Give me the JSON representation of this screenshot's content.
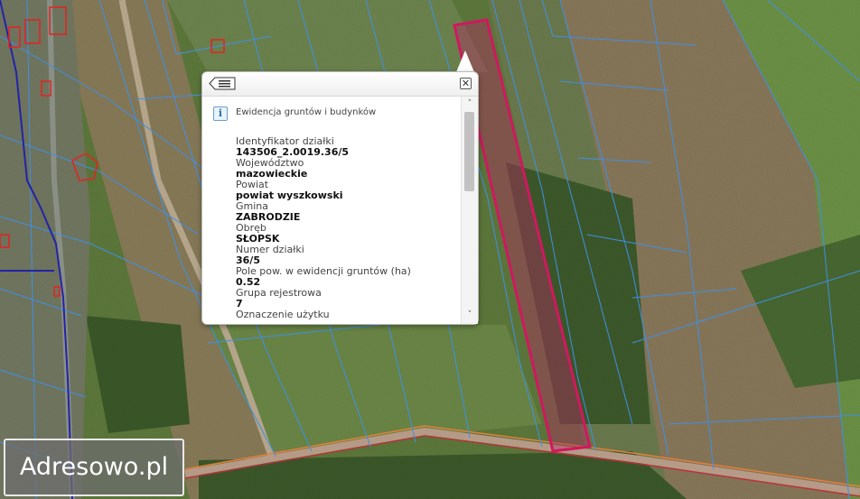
{
  "map": {
    "colors": {
      "field": "#5d7a3c",
      "parcel_line": "#3f8fe8",
      "highlight": "#d0185f",
      "building": "#e52222",
      "road": "#b59b87"
    }
  },
  "popup": {
    "list_icon": "list-back-icon",
    "close_icon": "close-icon",
    "layer_icon": "info-icon",
    "layer_icon_glyph": "i",
    "layer_title": "Ewidencja gruntów i budynków",
    "fields": [
      {
        "label": "Identyfikator działki",
        "value": "143506_2.0019.36/5"
      },
      {
        "label": "Województwo",
        "value": "mazowieckie"
      },
      {
        "label": "Powiat",
        "value": "powiat wyszkowski"
      },
      {
        "label": "Gmina",
        "value": "ZABRODZIE"
      },
      {
        "label": "Obręb",
        "value": "SŁOPSK"
      },
      {
        "label": "Numer działki",
        "value": "36/5"
      },
      {
        "label": "Pole pow. w ewidencji gruntów (ha)",
        "value": "0.52"
      },
      {
        "label": "Grupa rejestrowa",
        "value": "7"
      },
      {
        "label": "Oznaczenie użytku",
        "value": ""
      }
    ],
    "scrollbar": {
      "up_icon": "chevron-up-icon",
      "down_icon": "chevron-down-icon"
    }
  },
  "brand": {
    "text": "Adresowo.pl"
  }
}
